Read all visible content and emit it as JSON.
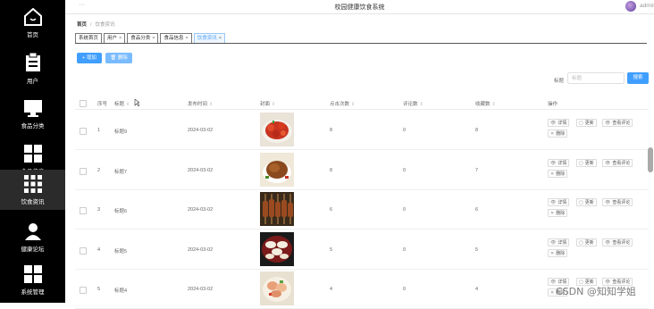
{
  "app": {
    "title": "校园健康饮食系统",
    "user": "admin",
    "menu_dots": "···"
  },
  "sidebar": {
    "items": [
      {
        "label": "首页",
        "icon": "home-icon"
      },
      {
        "label": "用户",
        "icon": "clipboard-icon"
      },
      {
        "label": "食品分类",
        "icon": "monitor-icon"
      },
      {
        "label": "食品信息",
        "icon": "grid-4-icon"
      },
      {
        "label": "饮食资讯",
        "icon": "grid-9-icon",
        "active": true
      },
      {
        "label": "健康论坛",
        "icon": "person-icon"
      },
      {
        "label": "系统管理",
        "icon": "grid-4-icon"
      }
    ]
  },
  "breadcrumb": {
    "home": "首页",
    "separator": "/",
    "current": "饮食资讯"
  },
  "tabs": [
    {
      "label": "系统首页",
      "closable": false
    },
    {
      "label": "用户",
      "closable": true
    },
    {
      "label": "食品分类",
      "closable": true
    },
    {
      "label": "食品信息",
      "closable": true
    },
    {
      "label": "饮食资讯",
      "closable": true,
      "active": true
    }
  ],
  "toolbar": {
    "add_label": "+ 增加",
    "delete_label": "删除"
  },
  "search": {
    "label": "标题",
    "placeholder": "标题",
    "button_label": "搜索"
  },
  "table": {
    "headers": {
      "index": "序号",
      "title": "标题",
      "publish_time": "发布时间",
      "cover": "封面",
      "clicks": "点击次数",
      "comments": "评论数",
      "favorites": "收藏数",
      "actions": "操作"
    },
    "sort_glyph": "⇕",
    "rows": [
      {
        "index": "1",
        "title": "标题9",
        "publish_time": "2024-03-02",
        "clicks": "8",
        "comments": "0",
        "favorites": "8",
        "image": "food-image-crayfish"
      },
      {
        "index": "2",
        "title": "标题7",
        "publish_time": "2024-03-02",
        "clicks": "8",
        "comments": "0",
        "favorites": "7",
        "image": "food-image-roast-chicken"
      },
      {
        "index": "3",
        "title": "标题6",
        "publish_time": "2024-03-02",
        "clicks": "6",
        "comments": "0",
        "favorites": "6",
        "image": "food-image-skewers"
      },
      {
        "index": "4",
        "title": "标题5",
        "publish_time": "2024-03-02",
        "clicks": "5",
        "comments": "0",
        "favorites": "5",
        "image": "food-image-dumplings"
      },
      {
        "index": "5",
        "title": "标题4",
        "publish_time": "2024-03-02",
        "clicks": "4",
        "comments": "0",
        "favorites": "4",
        "image": "food-image-salad"
      }
    ],
    "action_labels": {
      "detail": "详情",
      "update": "更新",
      "view_comments": "查看评论",
      "delete": "删除"
    }
  },
  "watermark": "CSDN @知知学姐",
  "colors": {
    "primary": "#409eff",
    "primary_light": "#79bbff",
    "sidebar_bg": "#000000"
  }
}
